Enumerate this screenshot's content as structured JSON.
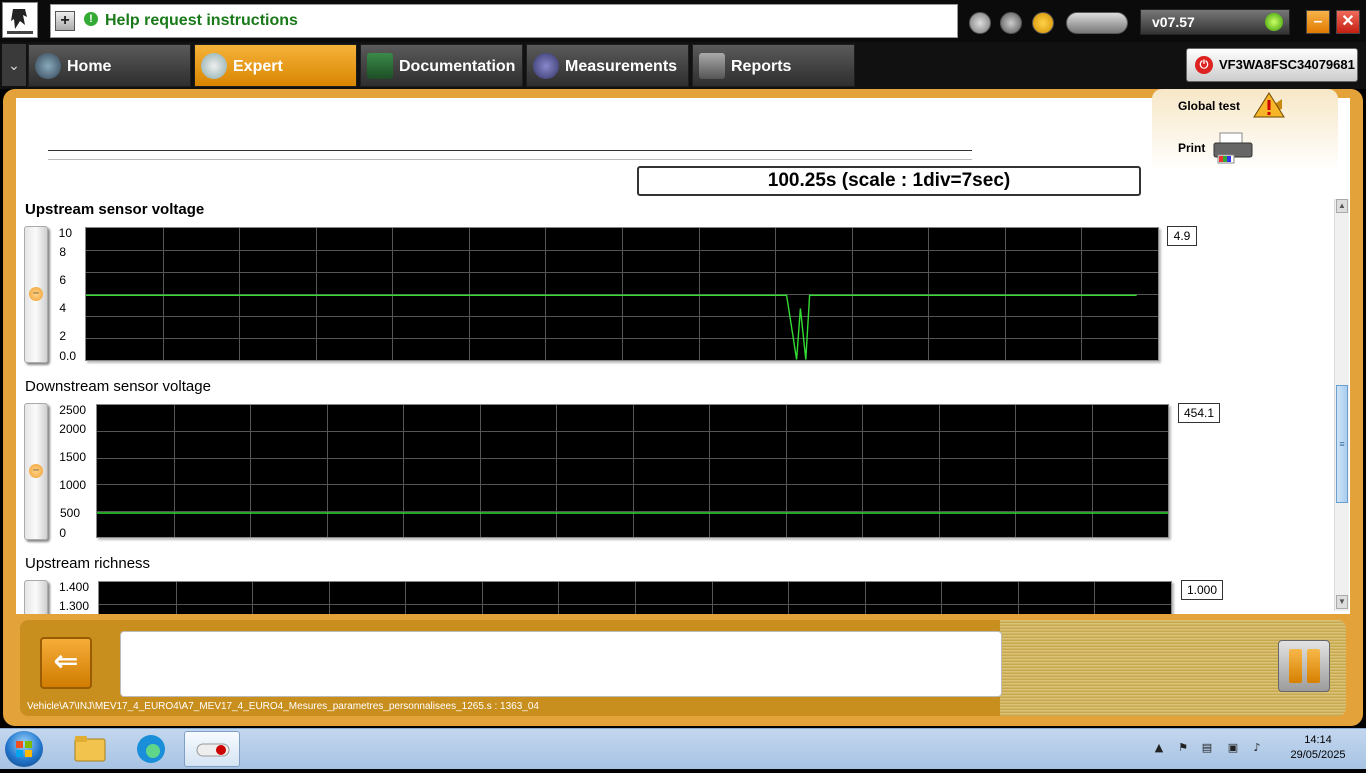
{
  "app": {
    "help_text": "Help request instructions",
    "version": "v07.57",
    "vin": "VF3WA8FSC34079681"
  },
  "tabs": [
    {
      "label": "Home",
      "active": false
    },
    {
      "label": "Expert",
      "active": true
    },
    {
      "label": "Documentation",
      "active": false
    },
    {
      "label": "Measurements",
      "active": false
    },
    {
      "label": "Reports",
      "active": false
    }
  ],
  "side_panel": {
    "global_test": "Global test",
    "print": "Print"
  },
  "timebar": {
    "text": "100.25s (scale : 1div=7sec)"
  },
  "graphs": [
    {
      "title": "Upstream sensor voltage",
      "current_value": "4.9",
      "yticks": [
        "10",
        "8",
        "6",
        "4",
        "2",
        "0.0"
      ]
    },
    {
      "title": "Downstream sensor voltage",
      "current_value": "454.1",
      "yticks": [
        "2500",
        "2000",
        "1500",
        "1000",
        "500",
        "0"
      ]
    },
    {
      "title": "Upstream richness",
      "current_value": "1.000",
      "yticks": [
        "1.400",
        "1.300"
      ]
    }
  ],
  "chart_data": [
    {
      "type": "line",
      "title": "Upstream sensor voltage",
      "ylim": [
        0,
        10
      ],
      "x_divisions": 14,
      "y_divisions": 6,
      "grid": true,
      "series": [
        {
          "x": [
            0,
            91.5,
            92.8,
            93.3,
            94,
            94.5,
            96,
            137.2
          ],
          "y": [
            4.9,
            4.9,
            0,
            3.9,
            0,
            4.9,
            4.9,
            4.9
          ]
        }
      ]
    },
    {
      "type": "line",
      "title": "Downstream sensor voltage",
      "ylim": [
        0,
        2500
      ],
      "x_divisions": 14,
      "y_divisions": 5,
      "grid": true,
      "series": [
        {
          "x": [
            0,
            140
          ],
          "y": [
            454.1,
            454.1
          ]
        }
      ]
    },
    {
      "type": "line",
      "title": "Upstream richness",
      "ylim": [
        1.3,
        1.4
      ],
      "x_divisions": 14,
      "grid": true,
      "series": []
    }
  ],
  "bottom": {
    "path": "Vehicle\\A7\\INJ\\MEV17_4_EURO4\\A7_MEV17_4_EURO4_Mesures_parametres_personnalisees_1265.s : 1363_04"
  },
  "taskbar": {
    "time": "14:14",
    "date": "29/05/2025"
  },
  "colors": {
    "accent": "#e3a33a",
    "trace": "#33dd33",
    "grid": "#555555",
    "plot_bg": "#000000"
  }
}
